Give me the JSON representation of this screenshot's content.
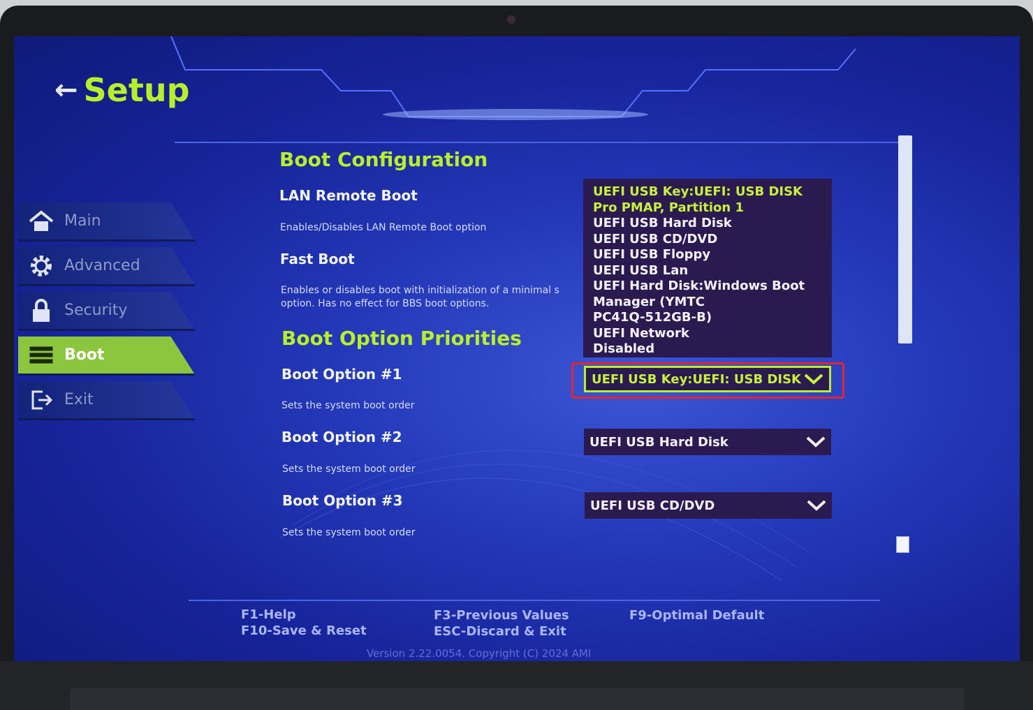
{
  "header": {
    "back_arrow": "←",
    "title": "Setup"
  },
  "sidebar": {
    "items": [
      {
        "label": "Main",
        "icon": "home-icon",
        "active": false
      },
      {
        "label": "Advanced",
        "icon": "gear-icon",
        "active": false
      },
      {
        "label": "Security",
        "icon": "lock-icon",
        "active": false
      },
      {
        "label": "Boot",
        "icon": "boot-list-icon",
        "active": true
      },
      {
        "label": "Exit",
        "icon": "exit-icon",
        "active": false
      }
    ]
  },
  "boot_configuration": {
    "title": "Boot Configuration",
    "lan_remote_boot": {
      "label": "LAN Remote Boot",
      "description": "Enables/Disables LAN Remote Boot option"
    },
    "fast_boot": {
      "label": "Fast Boot",
      "description_line1": "Enables or disables boot with initialization of a minimal s",
      "description_line2": "option. Has no effect for BBS boot options."
    }
  },
  "boot_option_list": {
    "options": [
      "UEFI USB Key:UEFI:  USB DISK",
      "Pro PMAP, Partition 1",
      "UEFI USB Hard Disk",
      "UEFI USB CD/DVD",
      "UEFI USB Floppy",
      "UEFI USB Lan",
      "UEFI Hard Disk:Windows Boot",
      "Manager (YMTC",
      "PC41Q-512GB-B)",
      "UEFI Network",
      "Disabled"
    ]
  },
  "boot_option_priorities": {
    "title": "Boot Option Priorities",
    "options": [
      {
        "label": "Boot Option #1",
        "description": "Sets the system boot order",
        "value": "UEFI USB Key:UEFI:  USB DISK"
      },
      {
        "label": "Boot Option #2",
        "description": "Sets the system boot order",
        "value": "UEFI USB Hard Disk"
      },
      {
        "label": "Boot Option #3",
        "description": "Sets the system boot order",
        "value": "UEFI USB CD/DVD"
      }
    ]
  },
  "footer": {
    "f1": "F1-Help",
    "f10": "F10-Save & Reset",
    "f3": "F3-Previous Values",
    "esc": "ESC-Discard & Exit",
    "f9": "F9-Optimal Default",
    "copyright": "Version 2.22.0054. Copyright (C) 2024 AMI"
  },
  "colors": {
    "accent_green": "#b8ef2a",
    "active_tab": "#8cc63f",
    "highlight_red": "#e5252d",
    "screen_blue": "#2338b8",
    "listbox_bg": "#2b1a50"
  }
}
